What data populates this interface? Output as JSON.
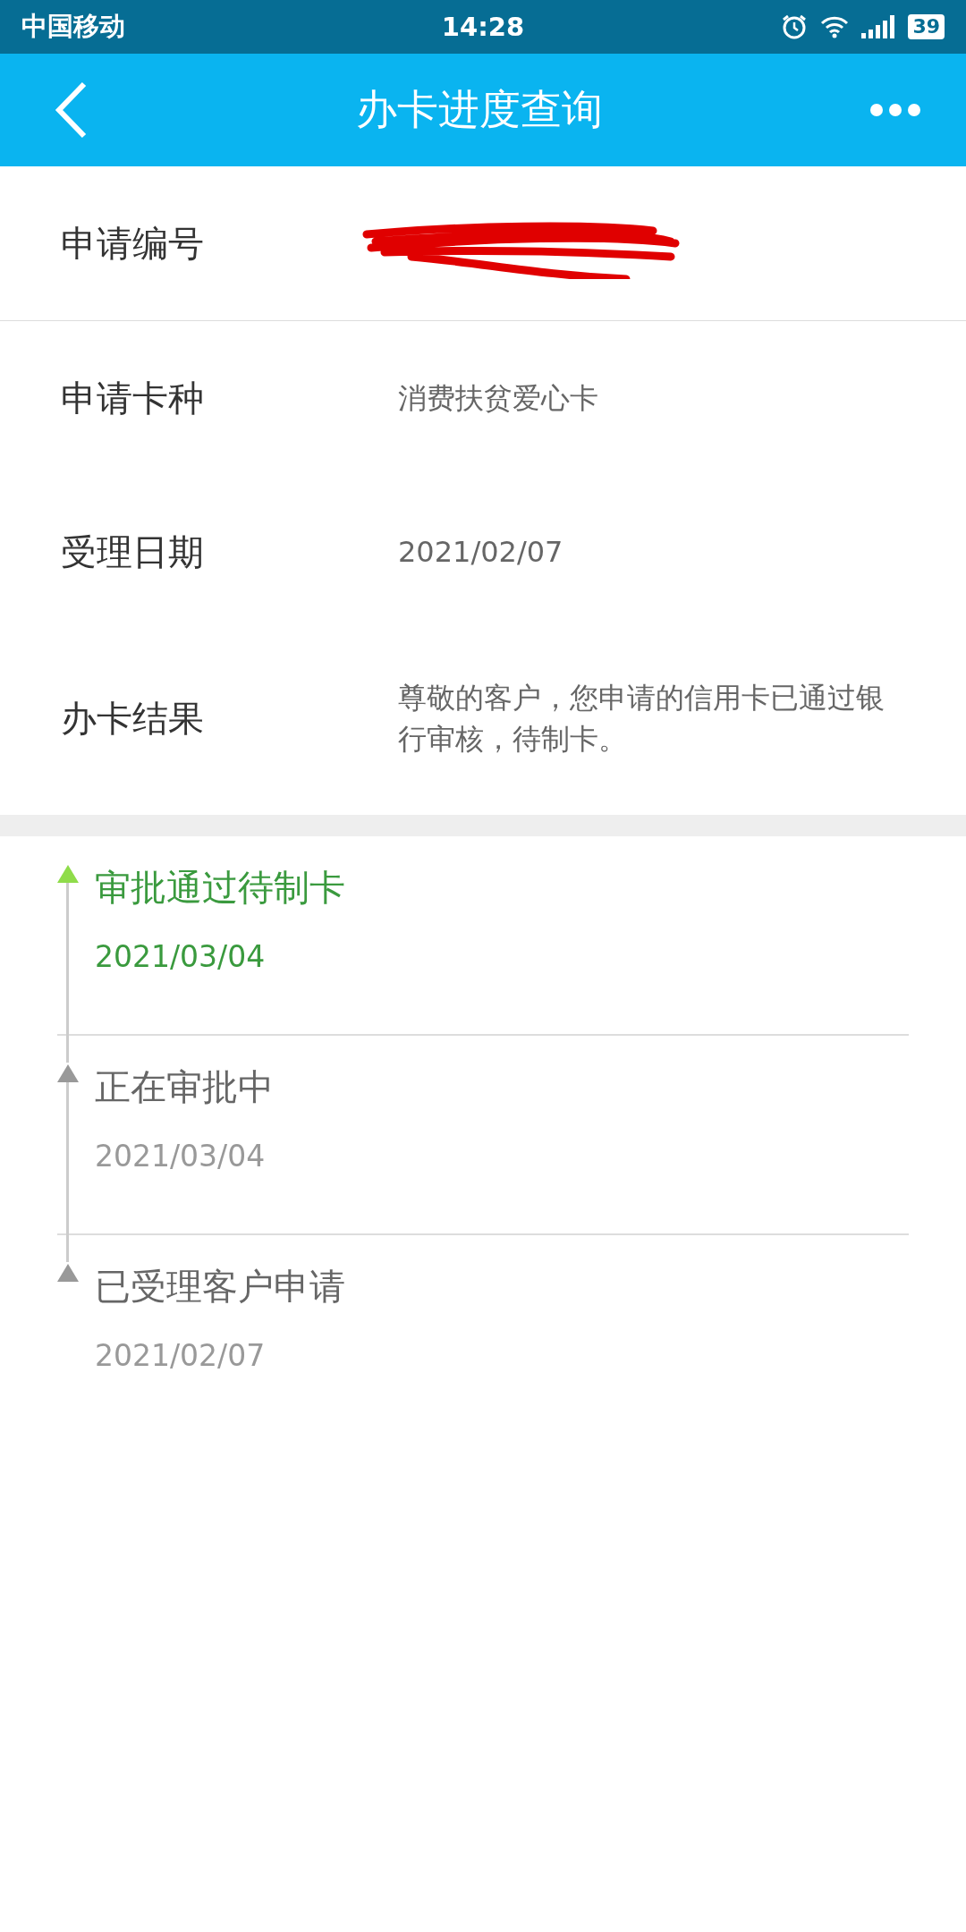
{
  "status_bar": {
    "carrier": "中国移动",
    "time": "14:28",
    "battery": "39"
  },
  "nav": {
    "title": "办卡进度查询"
  },
  "fields": [
    {
      "label": "申请编号",
      "redacted": true
    },
    {
      "label": "申请卡种",
      "value": "消费扶贫爱心卡"
    },
    {
      "label": "受理日期",
      "value": "2021/02/07"
    },
    {
      "label": "办卡结果",
      "value": "尊敬的客户，您申请的信用卡已通过银行审核，待制卡。"
    }
  ],
  "timeline": [
    {
      "title": "审批通过待制卡",
      "date": "2021/03/04",
      "current": true
    },
    {
      "title": "正在审批中",
      "date": "2021/03/04",
      "current": false
    },
    {
      "title": "已受理客户申请",
      "date": "2021/02/07",
      "current": false
    }
  ]
}
